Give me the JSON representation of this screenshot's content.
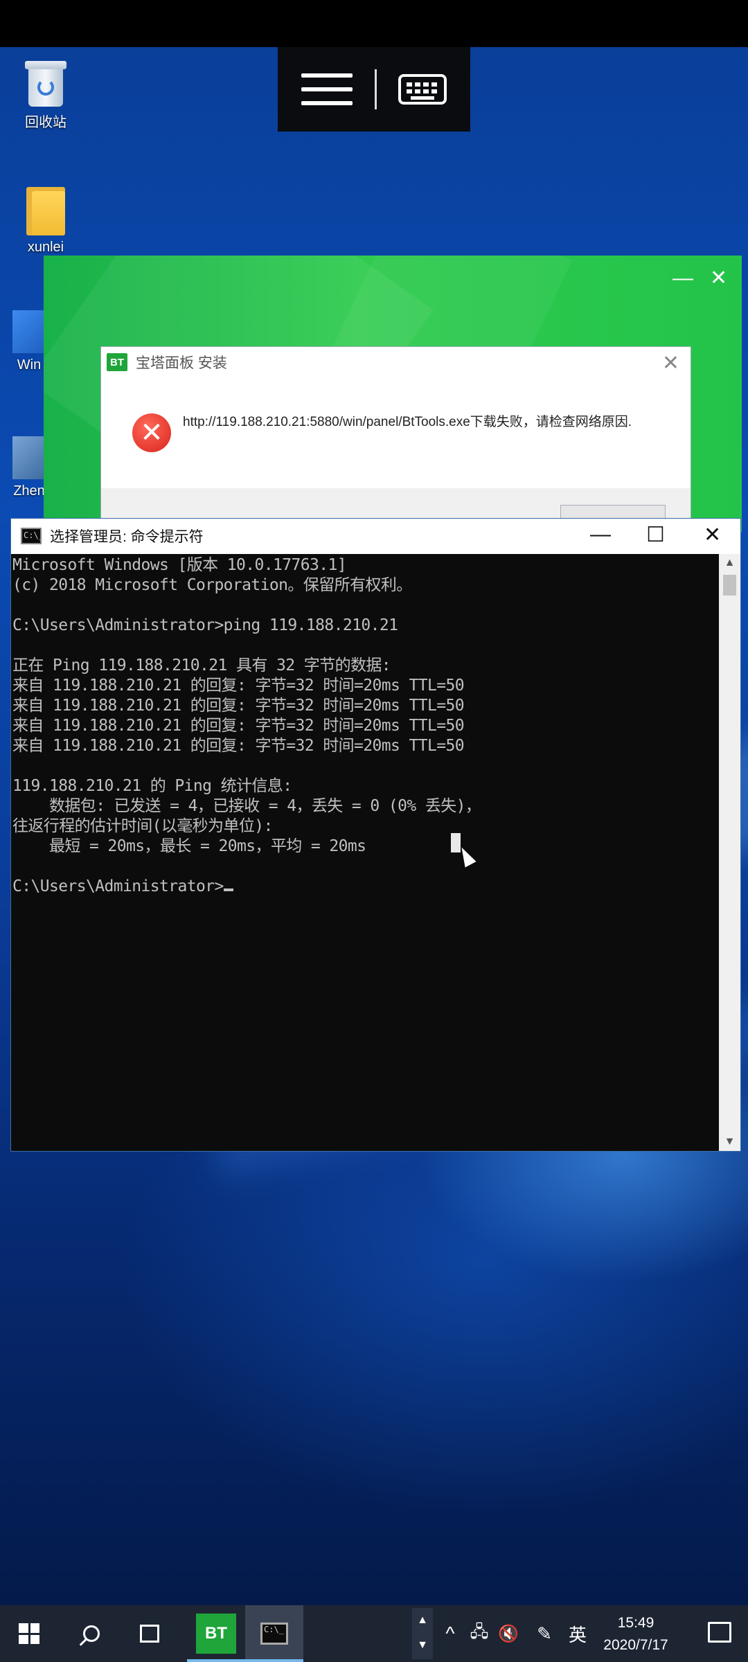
{
  "desktop": {
    "icons": [
      {
        "label": "回收站"
      },
      {
        "label": "xunlei"
      },
      {
        "label": "Win"
      },
      {
        "label": "Zhen"
      }
    ]
  },
  "bt_installer": {
    "minimize": "—",
    "close": "✕"
  },
  "bt_dialog": {
    "badge": "BT",
    "title": "宝塔面板 安装",
    "close": "✕",
    "message": "http://119.188.210.21:5880/win/panel/BtTools.exe下载失败，请检查网络原因."
  },
  "cmd": {
    "title": "选择管理员: 命令提示符",
    "icon_text": "C:\\_",
    "controls": {
      "minimize": "—",
      "maximize": "☐",
      "close": "✕"
    },
    "lines": [
      "Microsoft Windows [版本 10.0.17763.1]",
      "(c) 2018 Microsoft Corporation。保留所有权利。",
      "",
      "C:\\Users\\Administrator>ping 119.188.210.21",
      "",
      "正在 Ping 119.188.210.21 具有 32 字节的数据:",
      "来自 119.188.210.21 的回复: 字节=32 时间=20ms TTL=50",
      "来自 119.188.210.21 的回复: 字节=32 时间=20ms TTL=50",
      "来自 119.188.210.21 的回复: 字节=32 时间=20ms TTL=50",
      "来自 119.188.210.21 的回复: 字节=32 时间=20ms TTL=50",
      "",
      "119.188.210.21 的 Ping 统计信息:",
      "    数据包: 已发送 = 4，已接收 = 4，丢失 = 0 (0% 丢失)，",
      "往返行程的估计时间(以毫秒为单位):",
      "    最短 = 20ms，最长 = 20ms，平均 = 20ms",
      "",
      "C:\\Users\\Administrator>"
    ]
  },
  "taskbar": {
    "bt_app": "BT",
    "ime": "英",
    "time": "15:49",
    "date": "2020/7/17",
    "tray_up": "^"
  }
}
